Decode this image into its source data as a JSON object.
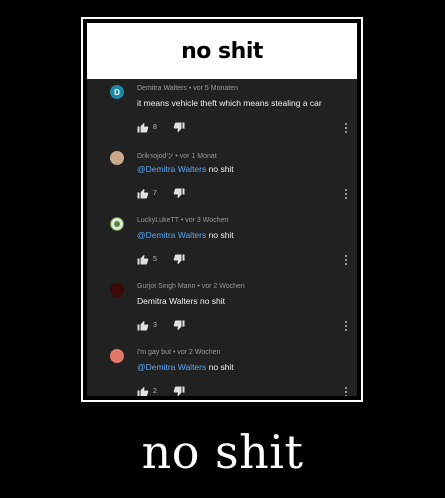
{
  "header": {
    "title": "no shit"
  },
  "comments": [
    {
      "author": "Demitra Walters",
      "time": "vor 5 Monaten",
      "avatar_letter": "D",
      "mention": "",
      "text": "it means vehicle theft which means stealing a car",
      "likes": "8",
      "avatar_color": "#1e88a8"
    },
    {
      "author": "Drikรojodツ",
      "time": "vor 1 Monat",
      "avatar_letter": "",
      "mention": "@Demitra Walters",
      "text": "no shit",
      "likes": "7",
      "avatar_color": "#c9a98c"
    },
    {
      "author": "LuckyLukeTT",
      "time": "vor 3 Wochen",
      "avatar_letter": "",
      "mention": "@Demitra Walters",
      "text": "no shit",
      "likes": "5",
      "avatar_color": "#5c8a3a"
    },
    {
      "author": "Gurjot Singh Mann",
      "time": "vor 2 Wochen",
      "avatar_letter": "",
      "mention": "",
      "text": "Demitra Walters no shit",
      "likes": "3",
      "avatar_color": "#3a0a0a"
    },
    {
      "author": "I'm gay but",
      "time": "vor 2 Wochen",
      "avatar_letter": "",
      "mention": "@Demitra Walters",
      "text": "no shit",
      "likes": "2",
      "avatar_color": "#e0786a"
    }
  ],
  "caption": "no shit",
  "icons": {
    "like": "thumbs-up-icon",
    "dislike": "thumbs-down-icon",
    "menu": "more-vert-icon"
  }
}
